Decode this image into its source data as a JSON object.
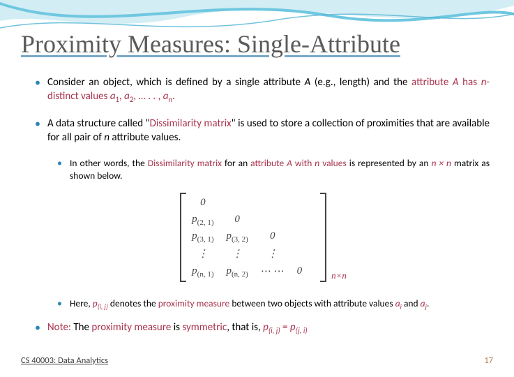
{
  "title": "Proximity Measures: Single-Attribute",
  "bullets": {
    "b1_pre": "Consider an object, which is defined by a single attribute ",
    "b1_A": "A",
    "b1_mid": " (e.g., length) and the ",
    "b1_hl1": "attribute ",
    "b1_hl_A": "A",
    "b1_hl2": " has ",
    "b1_hl_n": "n",
    "b1_hl3": "-distinct values ",
    "b1_vals_a": "a",
    "b1_s1": "1",
    "b1_sep": ", ",
    "b1_s2": "2",
    "b1_dots": ", … . . , ",
    "b1_sn": "n",
    "b1_end": ".",
    "b2_pre": "A data structure called \"",
    "b2_hl": "Dissimilarity matrix",
    "b2_post": "\" is used to store a collection of proximities that are available for all pair of ",
    "b2_n": "n",
    "b2_end": " attribute values.",
    "b21_pre": "In other words, the ",
    "b21_hl1": "Dissimilarity matrix",
    "b21_mid": " for an ",
    "b21_hl2a": "attribute ",
    "b21_hl2A": "A",
    "b21_hl2b": " with ",
    "b21_hl2n": "n",
    "b21_hl2c": " values",
    "b21_post": " is represented by an ",
    "b21_dim": "n × n",
    "b21_end": " matrix as shown below.",
    "b22_pre": "Here, ",
    "b22_p": "p",
    "b22_pij": "(i, j)",
    "b22_mid": " denotes the ",
    "b22_hl": "proximity measure",
    "b22_post": " between two objects with attribute values ",
    "b22_ai": "a",
    "b22_i": "i",
    "b22_and": " and ",
    "b22_aj": "a",
    "b22_j": "j",
    "b22_end": ".",
    "note_lbl": "Note:",
    "note_pre": " The ",
    "note_hl1": "proximity measure",
    "note_mid": " is ",
    "note_hl2": "symmetric",
    "note_post": ", that is, ",
    "note_pij_p": "p",
    "note_pij": "(i, j)",
    "note_eq": " = ",
    "note_pji_p": "p",
    "note_pji": "(j, i)"
  },
  "matrix": {
    "c_0": "0",
    "p": "p",
    "s21": "(2, 1)",
    "s31": "(3, 1)",
    "s32": "(3, 2)",
    "sn1": "(n, 1)",
    "sn2": "(n, 2)",
    "vdots": "⋮",
    "hdots": "⋯ ⋯",
    "dim": "n×n"
  },
  "footer": {
    "course": "CS 40003: Data Analytics",
    "page": "17"
  },
  "colors": {
    "accent": "#2a86b8",
    "highlight": "#a8334c",
    "wave": "#6fc7e0"
  }
}
